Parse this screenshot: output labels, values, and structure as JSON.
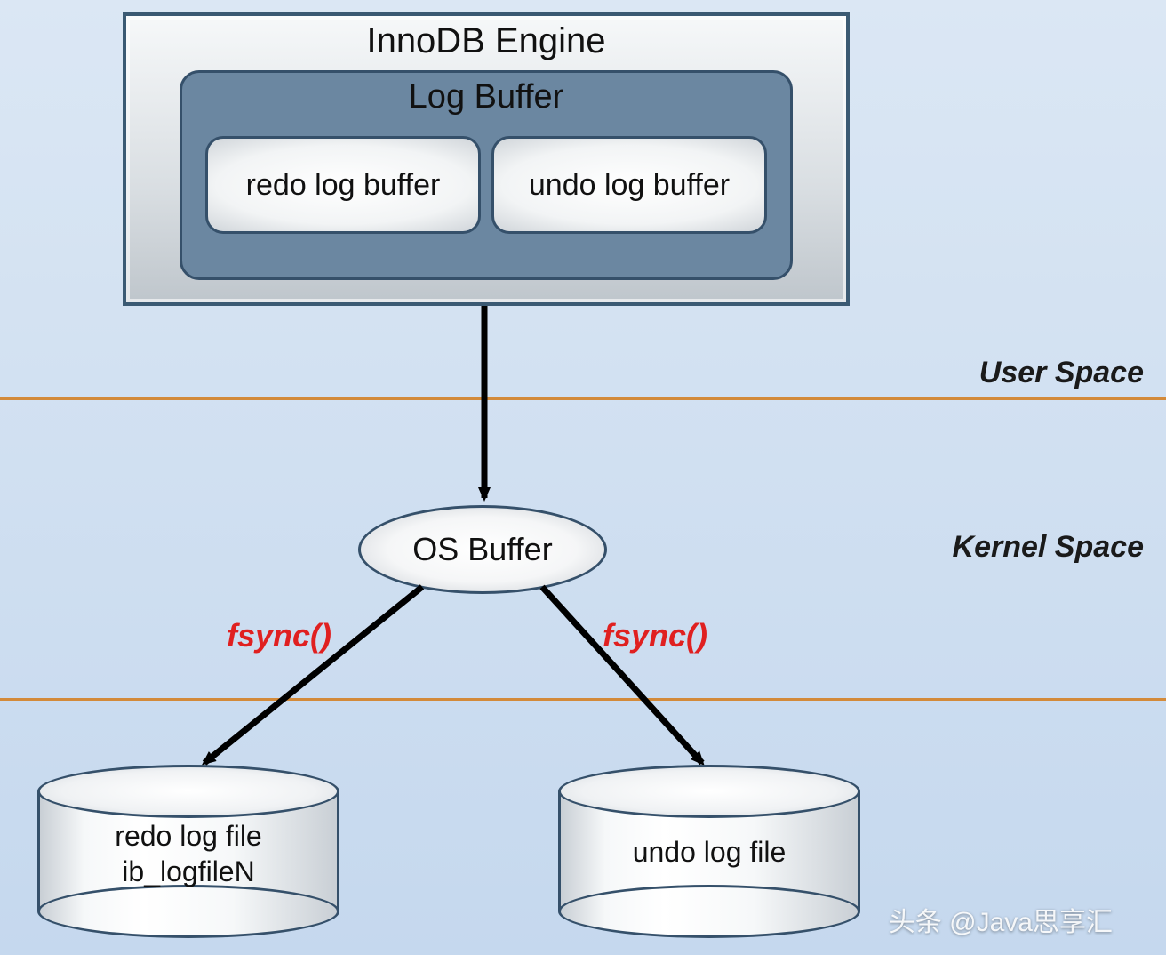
{
  "engine": {
    "title": "InnoDB Engine",
    "log_buffer_title": "Log Buffer",
    "redo_buffer": "redo log buffer",
    "undo_buffer": "undo log buffer"
  },
  "regions": {
    "user_space": "User Space",
    "kernel_space": "Kernel Space"
  },
  "os_buffer": "OS Buffer",
  "fsync_left": "fsync()",
  "fsync_right": "fsync()",
  "files": {
    "redo_line1": "redo log file",
    "redo_line2": "ib_logfileN",
    "undo": "undo log file"
  },
  "watermark": "头条 @Java思享汇"
}
